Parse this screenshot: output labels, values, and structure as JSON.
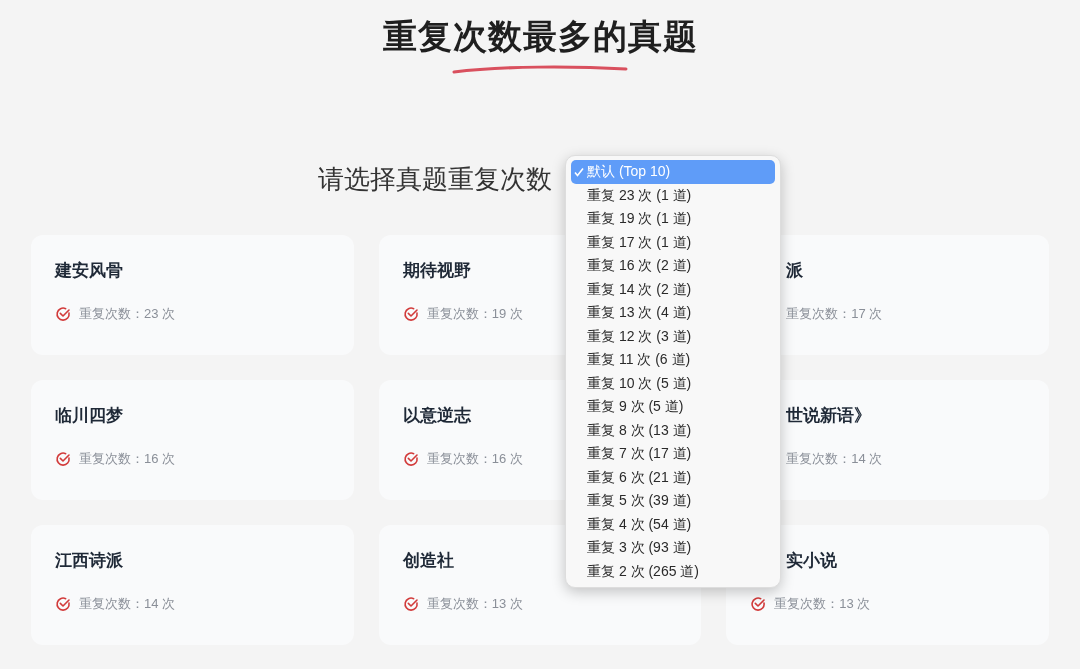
{
  "title": "重复次数最多的真题",
  "filter": {
    "label": "请选择真题重复次数"
  },
  "menu": [
    {
      "label": "默认 (Top 10)",
      "selected": true
    },
    {
      "label": "重复 23 次 (1 道)",
      "selected": false
    },
    {
      "label": "重复 19 次 (1 道)",
      "selected": false
    },
    {
      "label": "重复 17 次 (1 道)",
      "selected": false
    },
    {
      "label": "重复 16 次 (2 道)",
      "selected": false
    },
    {
      "label": "重复 14 次 (2 道)",
      "selected": false
    },
    {
      "label": "重复 13 次 (4 道)",
      "selected": false
    },
    {
      "label": "重复 12 次 (3 道)",
      "selected": false
    },
    {
      "label": "重复 11 次 (6 道)",
      "selected": false
    },
    {
      "label": "重复 10 次 (5 道)",
      "selected": false
    },
    {
      "label": "重复 9 次 (5 道)",
      "selected": false
    },
    {
      "label": "重复 8 次 (13 道)",
      "selected": false
    },
    {
      "label": "重复 7 次 (17 道)",
      "selected": false
    },
    {
      "label": "重复 6 次 (21 道)",
      "selected": false
    },
    {
      "label": "重复 5 次 (39 道)",
      "selected": false
    },
    {
      "label": "重复 4 次 (54 道)",
      "selected": false
    },
    {
      "label": "重复 3 次 (93 道)",
      "selected": false
    },
    {
      "label": "重复 2 次 (265 道)",
      "selected": false
    }
  ],
  "cards": [
    {
      "title": "建安风骨",
      "count": "重复次数：23 次",
      "check_icon": true
    },
    {
      "title": "期待视野",
      "count": "重复次数：19 次",
      "check_icon": true
    },
    {
      "title": "派",
      "count": "重复次数：17 次",
      "check_icon": false
    },
    {
      "title": "临川四梦",
      "count": "重复次数：16 次",
      "check_icon": true
    },
    {
      "title": "以意逆志",
      "count": "重复次数：16 次",
      "check_icon": true
    },
    {
      "title": "世说新语》",
      "count": "重复次数：14 次",
      "check_icon": false
    },
    {
      "title": "江西诗派",
      "count": "重复次数：14 次",
      "check_icon": true
    },
    {
      "title": "创造社",
      "count": "重复次数：13 次",
      "check_icon": true
    },
    {
      "title": "实小说",
      "count": "重复次数：13 次",
      "check_icon": true
    }
  ]
}
